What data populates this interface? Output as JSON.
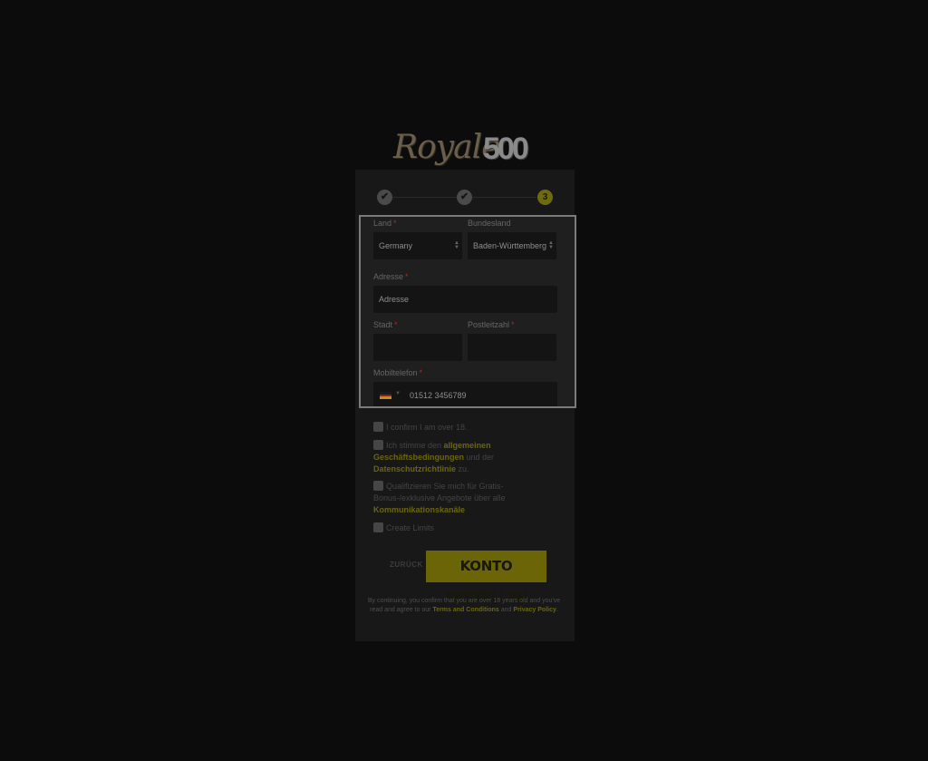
{
  "logo": {
    "script": "Royale",
    "number": "500"
  },
  "stepper": {
    "step3": "3"
  },
  "form": {
    "land": {
      "label": "Land",
      "value": "Germany"
    },
    "bundesland": {
      "label": "Bundesland",
      "value": "Baden-Württemberg"
    },
    "adresse": {
      "label": "Adresse",
      "placeholder": "Adresse"
    },
    "stadt": {
      "label": "Stadt",
      "value": ""
    },
    "plz": {
      "label": "Postleitzahl",
      "value": ""
    },
    "mobil": {
      "label": "Mobiltelefon",
      "value": "01512 3456789"
    },
    "required_mark": "*"
  },
  "checkboxes": {
    "age": "I confirm I am over 18.",
    "terms_pre": "Ich stimme den",
    "terms_link": "allgemeinen Geschäftsbedingungen",
    "terms_mid": "und der",
    "privacy_link": "Datenschutzrichtlinie",
    "terms_post": "zu.",
    "bonus_pre": "Qualifizieren Sie mich für Gratis-Bonus-/exklusive Angebote über alle",
    "bonus_link": "Kommunikationskanäle",
    "limits": "Create Limits"
  },
  "buttons": {
    "back": "ZURÜCK",
    "create": "KONTO ERSTELLEN"
  },
  "footer": {
    "text1": "By continuing, you confirm that you are over 18 years old and you've read and agree to our",
    "terms_link": "Terms and Conditions",
    "and": "and",
    "privacy_link": "Privacy Policy",
    "end": "."
  },
  "colors": {
    "accent": "#6b6508",
    "link": "#6b650f",
    "required": "#b8231b"
  }
}
